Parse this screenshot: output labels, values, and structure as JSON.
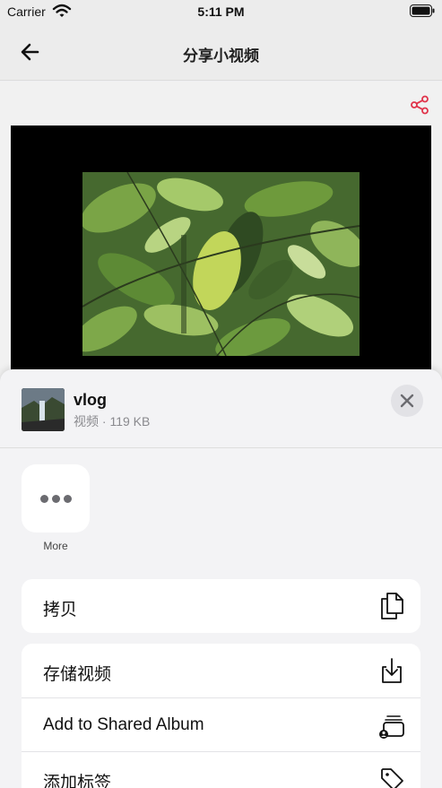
{
  "status_bar": {
    "carrier": "Carrier",
    "time": "5:11 PM"
  },
  "nav": {
    "title": "分享小视频",
    "back_icon": "arrow-left-icon"
  },
  "share_icon": {
    "icon": "share-icon",
    "color": "#e0334a"
  },
  "share_sheet": {
    "file": {
      "name": "vlog",
      "meta": "视频 · 119 KB"
    },
    "more": {
      "label": "More"
    },
    "actions_group_1": [
      {
        "label": "拷贝",
        "icon": "copy-icon"
      }
    ],
    "actions_group_2": [
      {
        "label": "存储视频",
        "icon": "save-download-icon"
      },
      {
        "label": "Add to Shared Album",
        "icon": "shared-album-icon"
      },
      {
        "label": "添加标签",
        "icon": "tag-icon"
      }
    ]
  }
}
